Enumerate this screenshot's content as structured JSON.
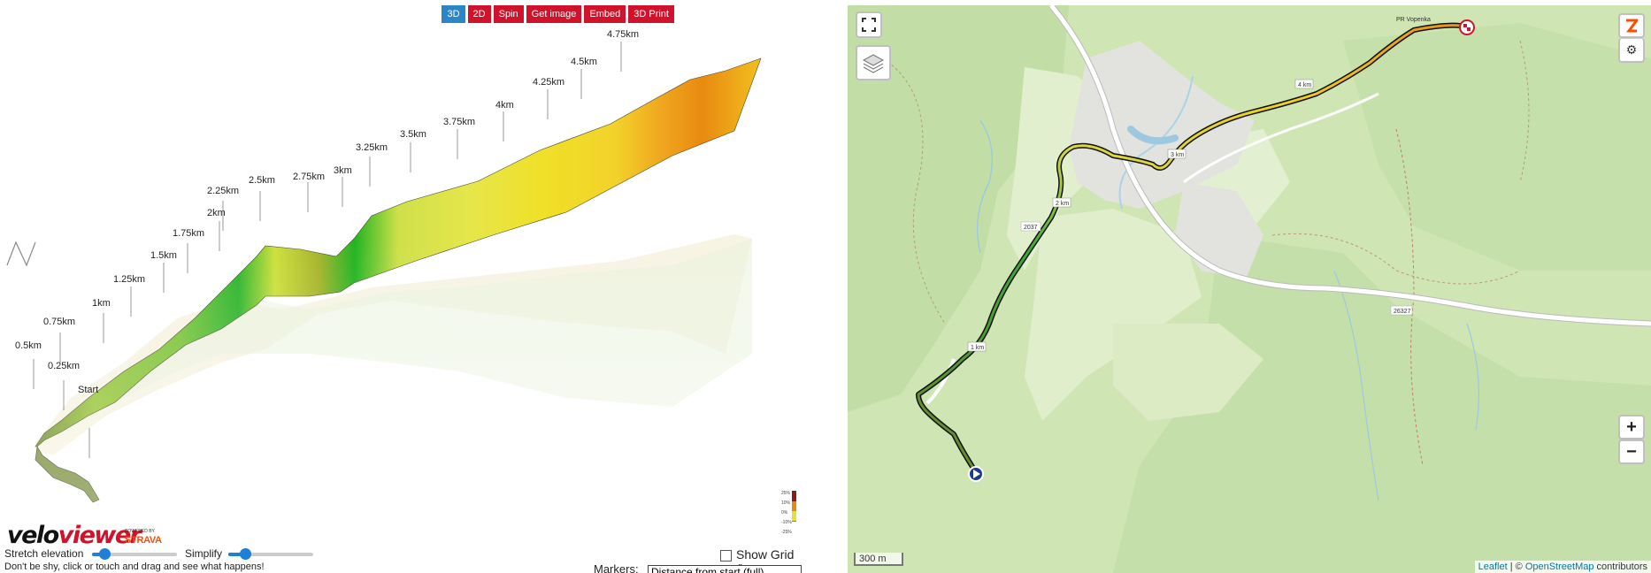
{
  "toolbar": {
    "btn_3d": "3D",
    "btn_2d": "2D",
    "btn_spin": "Spin",
    "btn_get_image": "Get image",
    "btn_embed": "Embed",
    "btn_3d_print": "3D Print"
  },
  "profile": {
    "markers": [
      "Start",
      "0.25km",
      "0.5km",
      "0.75km",
      "1km",
      "1.25km",
      "1.5km",
      "1.75km",
      "2km",
      "2.25km",
      "2.5km",
      "2.75km",
      "3km",
      "3.25km",
      "3.5km",
      "3.75km",
      "4km",
      "4.25km",
      "4.5km",
      "4.75km"
    ],
    "compass": "N"
  },
  "gradient_legend": {
    "labels": [
      "25%",
      "10%",
      "0%",
      "-10%",
      "-25%"
    ]
  },
  "branding": {
    "logo_part1": "velo",
    "logo_part2": "viewer",
    "powered_by": "POWERED BY",
    "strava": "STRAVA"
  },
  "controls": {
    "stretch_label": "Stretch elevation",
    "stretch_value": 0.15,
    "simplify_label": "Simplify",
    "simplify_value": 0.2,
    "show_grid_label": "Show Grid ()",
    "show_grid_checked": false,
    "hint": "Don't be shy, click or touch and drag and see what happens!",
    "markers_label": "Markers:",
    "markers_select": "Distance from start (full)"
  },
  "map": {
    "scale": "300 m",
    "attribution_leaflet": "Leaflet",
    "attribution_sep": " | © ",
    "attribution_osm": "OpenStreetMap",
    "attribution_tail": " contributors",
    "zoom_in": "+",
    "zoom_out": "−",
    "km_labels": [
      "1 km",
      "2 km",
      "3 km",
      "4 km"
    ],
    "road_labels": [
      "26327",
      "2037"
    ],
    "place_labels": [
      "PR Vopenka"
    ]
  }
}
